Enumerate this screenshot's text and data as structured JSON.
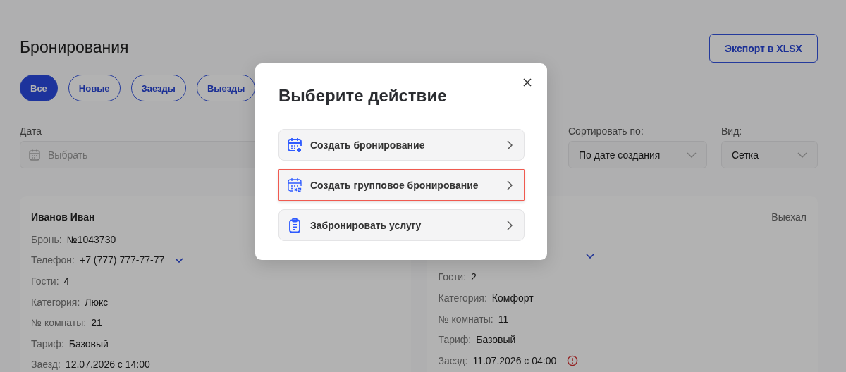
{
  "page": {
    "title": "Бронирования",
    "export_button": "Экспорт в XLSX"
  },
  "tabs": [
    {
      "label": "Все",
      "selected": true
    },
    {
      "label": "Новые",
      "selected": false
    },
    {
      "label": "Заезды",
      "selected": false
    },
    {
      "label": "Выезды",
      "selected": false
    }
  ],
  "filters": {
    "date": {
      "label": "Дата",
      "placeholder": "Выбрать"
    },
    "sort": {
      "label": "Сортировать по:",
      "value": "По дате создания"
    },
    "view": {
      "label": "Вид:",
      "value": "Сетка"
    }
  },
  "cards": [
    {
      "name": "Иванов Иван",
      "fields": [
        {
          "label": "Бронь:",
          "value": "№1043730",
          "kind": "plain"
        },
        {
          "label": "Телефон:",
          "value": "+7 (777) 777-77-77",
          "kind": "phone"
        },
        {
          "label": "Гости:",
          "value": "4",
          "kind": "plain"
        },
        {
          "label": "Категория:",
          "value": "Люкс",
          "kind": "plain"
        },
        {
          "label": "№ комнаты:",
          "value": "21",
          "kind": "plain"
        },
        {
          "label": "Тариф:",
          "value": "Базовый",
          "kind": "plain"
        },
        {
          "label": "Заезд:",
          "value": "12.07.2026 с 14:00",
          "kind": "plain"
        }
      ]
    },
    {
      "status": "Выехал",
      "fields": [
        {
          "kind": "phone"
        },
        {
          "label": "Гости:",
          "value": "2",
          "kind": "plain"
        },
        {
          "label": "Категория:",
          "value": "Комфорт",
          "kind": "plain"
        },
        {
          "label": "№ комнаты:",
          "value": "11",
          "kind": "plain"
        },
        {
          "label": "Тариф:",
          "value": "Базовый",
          "kind": "plain"
        },
        {
          "label": "Заезд:",
          "value": "11.07.2026 с 04:00",
          "kind": "alert"
        }
      ]
    }
  ],
  "modal": {
    "title": "Выберите действие",
    "options": [
      {
        "label": "Создать бронирование",
        "kind": "calendar-plus",
        "selected": false
      },
      {
        "label": "Создать групповое бронирование",
        "kind": "calendar-group",
        "selected": true
      },
      {
        "label": "Забронировать услугу",
        "kind": "clipboard",
        "selected": false
      }
    ]
  }
}
